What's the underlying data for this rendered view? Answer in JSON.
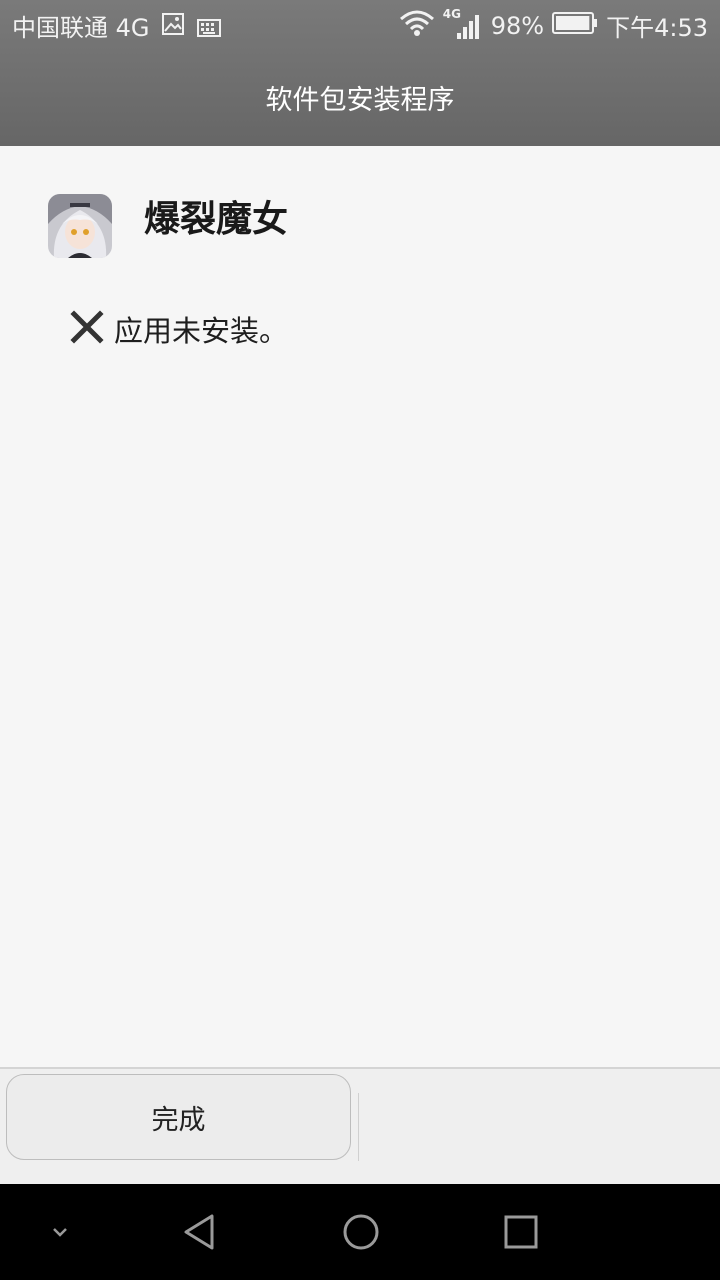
{
  "status_bar": {
    "carrier": "中国联通 4G",
    "network_small_label": "4G",
    "battery_percent": "98%",
    "battery_level": 0.98,
    "time": "下午4:53",
    "icons": [
      "image-notification-icon",
      "keyboard-icon",
      "wifi-icon",
      "signal-icon",
      "battery-icon"
    ]
  },
  "header": {
    "title": "软件包安装程序"
  },
  "app": {
    "name": "爆裂魔女",
    "icon": "app-icon-anime-character"
  },
  "result": {
    "icon": "close-x-icon",
    "message": "应用未安装。"
  },
  "actions": {
    "done_label": "完成"
  },
  "nav_bar": {
    "icons": [
      "collapse-chevron-icon",
      "back-icon",
      "home-icon",
      "recents-icon"
    ]
  },
  "colors": {
    "header_bg": "#6e6e6e",
    "content_bg": "#f6f6f6",
    "button_area_bg": "#efefef",
    "nav_bg": "#000000"
  }
}
